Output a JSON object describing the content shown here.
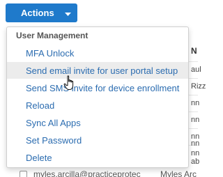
{
  "toolbar": {
    "actions_label": "Actions",
    "accent_color": "#1f7acb"
  },
  "table": {
    "column_header_fragment": "N",
    "cell_fragments": [
      "aul",
      "Rizz",
      "nn",
      "nn",
      "nn",
      "nn",
      "nn",
      "ab"
    ],
    "bottom_row": {
      "email": "myles.arcilla@practiceprotec",
      "name": "Myles Arc"
    }
  },
  "menu": {
    "header": "User Management",
    "items": [
      {
        "label": "MFA Unlock"
      },
      {
        "label": "Send email invite for user portal setup",
        "highlighted": true
      },
      {
        "label": "Send SMS invite for device enrollment"
      },
      {
        "label": "Reload"
      },
      {
        "label": "Sync All Apps"
      },
      {
        "label": "Set Password"
      },
      {
        "label": "Delete"
      }
    ],
    "item_text_color": "#2b6cb0",
    "highlight_color": "#ececec"
  },
  "cursor": {
    "icon": "hand-pointer-icon"
  }
}
